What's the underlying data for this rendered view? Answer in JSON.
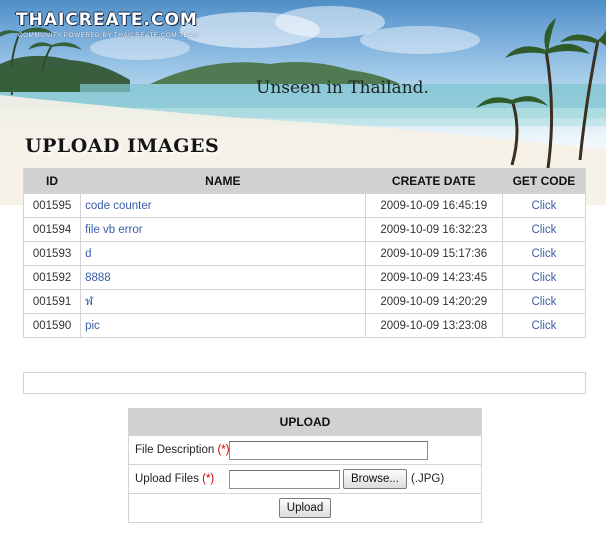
{
  "header": {
    "site_logo": "THAICREATE.COM",
    "site_tagline": "COMMUNITY POWERED BY THAICREATE.COM TEAM",
    "slogan": "Unseen in Thailand."
  },
  "page_title": "UPLOAD IMAGES",
  "images_table": {
    "columns": [
      "ID",
      "NAME",
      "CREATE DATE",
      "GET CODE"
    ],
    "rows": [
      {
        "id": "001595",
        "name": "code counter",
        "date": "2009-10-09 16:45:19",
        "action": "Click"
      },
      {
        "id": "001594",
        "name": "file vb error",
        "date": "2009-10-09 16:32:23",
        "action": "Click"
      },
      {
        "id": "001593",
        "name": "d",
        "date": "2009-10-09 15:17:36",
        "action": "Click"
      },
      {
        "id": "001592",
        "name": "8888",
        "date": "2009-10-09 14:23:45",
        "action": "Click"
      },
      {
        "id": "001591",
        "name": "ฬ",
        "date": "2009-10-09 14:20:29",
        "action": "Click"
      },
      {
        "id": "001590",
        "name": "pic",
        "date": "2009-10-09 13:23:08",
        "action": "Click"
      }
    ]
  },
  "upload_form": {
    "title": "UPLOAD",
    "description_label": "File Description",
    "files_label": "Upload Files",
    "required_mark": "(*)",
    "description_value": "",
    "browse_label": "Browse...",
    "file_type_hint": "(.JPG)",
    "submit_label": "Upload"
  }
}
